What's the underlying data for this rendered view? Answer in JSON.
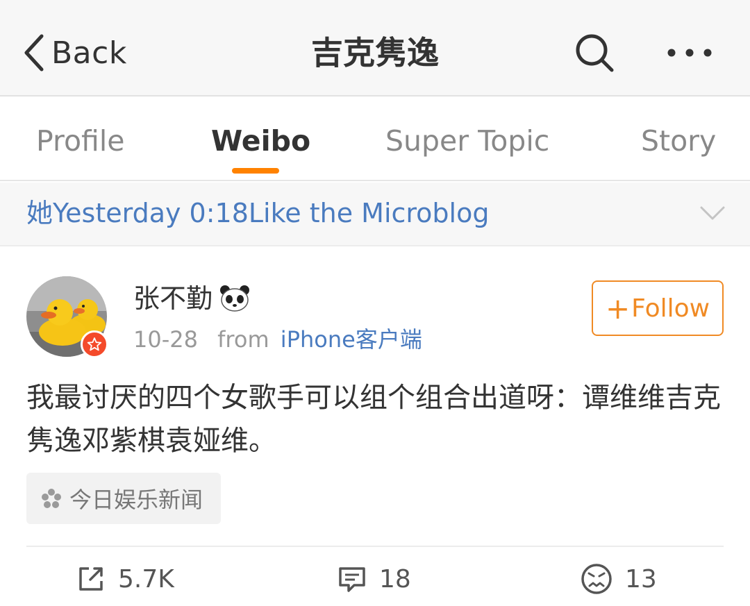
{
  "nav": {
    "back_label": "Back",
    "title": "吉克隽逸",
    "icons": [
      "chevron-left-icon",
      "search-icon",
      "more-icon"
    ]
  },
  "tabs": [
    {
      "label": "Profile",
      "active": false
    },
    {
      "label": "Weibo",
      "active": true
    },
    {
      "label": "Super Topic",
      "active": false
    },
    {
      "label": "Story",
      "active": false
    }
  ],
  "notice": {
    "text": "她Yesterday 0:18Like the Microblog"
  },
  "post": {
    "username": "张不勤",
    "date": "10-28",
    "from_label": "from",
    "source": "iPhone客户端",
    "follow_label": "Follow",
    "content": "我最讨厌的四个女歌手可以组个组合出道呀：谭维维吉克隽逸邓紫棋袁娅维。",
    "topic": "今日娱乐新闻",
    "actions": {
      "repost_count": "5.7K",
      "comment_count": "18",
      "like_count": "13"
    }
  },
  "colors": {
    "accent_orange": "#ff8200",
    "follow_orange": "#f08a24",
    "link_blue": "#4a7bbf",
    "badge_red": "#f44a2a"
  }
}
